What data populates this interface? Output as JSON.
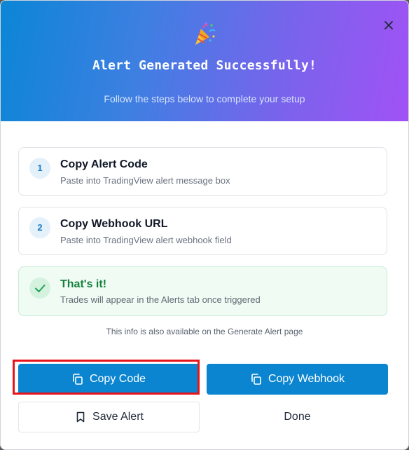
{
  "dialog": {
    "icon": "party-popper-icon",
    "title": "Alert Generated Successfully!",
    "subtitle": "Follow the steps below to complete your setup",
    "close_icon": "close-icon"
  },
  "steps": [
    {
      "number": "1",
      "title": "Copy Alert Code",
      "description": "Paste into TradingView alert message box"
    },
    {
      "number": "2",
      "title": "Copy Webhook URL",
      "description": "Paste into TradingView alert webhook field"
    }
  ],
  "success": {
    "icon": "check-icon",
    "title": "That's it!",
    "description": "Trades will appear in the Alerts tab once triggered"
  },
  "info_note": "This info is also available on the Generate Alert page",
  "buttons": {
    "copy_code": "Copy Code",
    "copy_webhook": "Copy Webhook",
    "save_alert": "Save Alert",
    "done": "Done"
  },
  "colors": {
    "header_gradient_start": "#0b86d6",
    "header_gradient_end": "#a152f5",
    "primary": "#0b85d0",
    "success": "#15803d",
    "highlight": "#e8141b"
  }
}
